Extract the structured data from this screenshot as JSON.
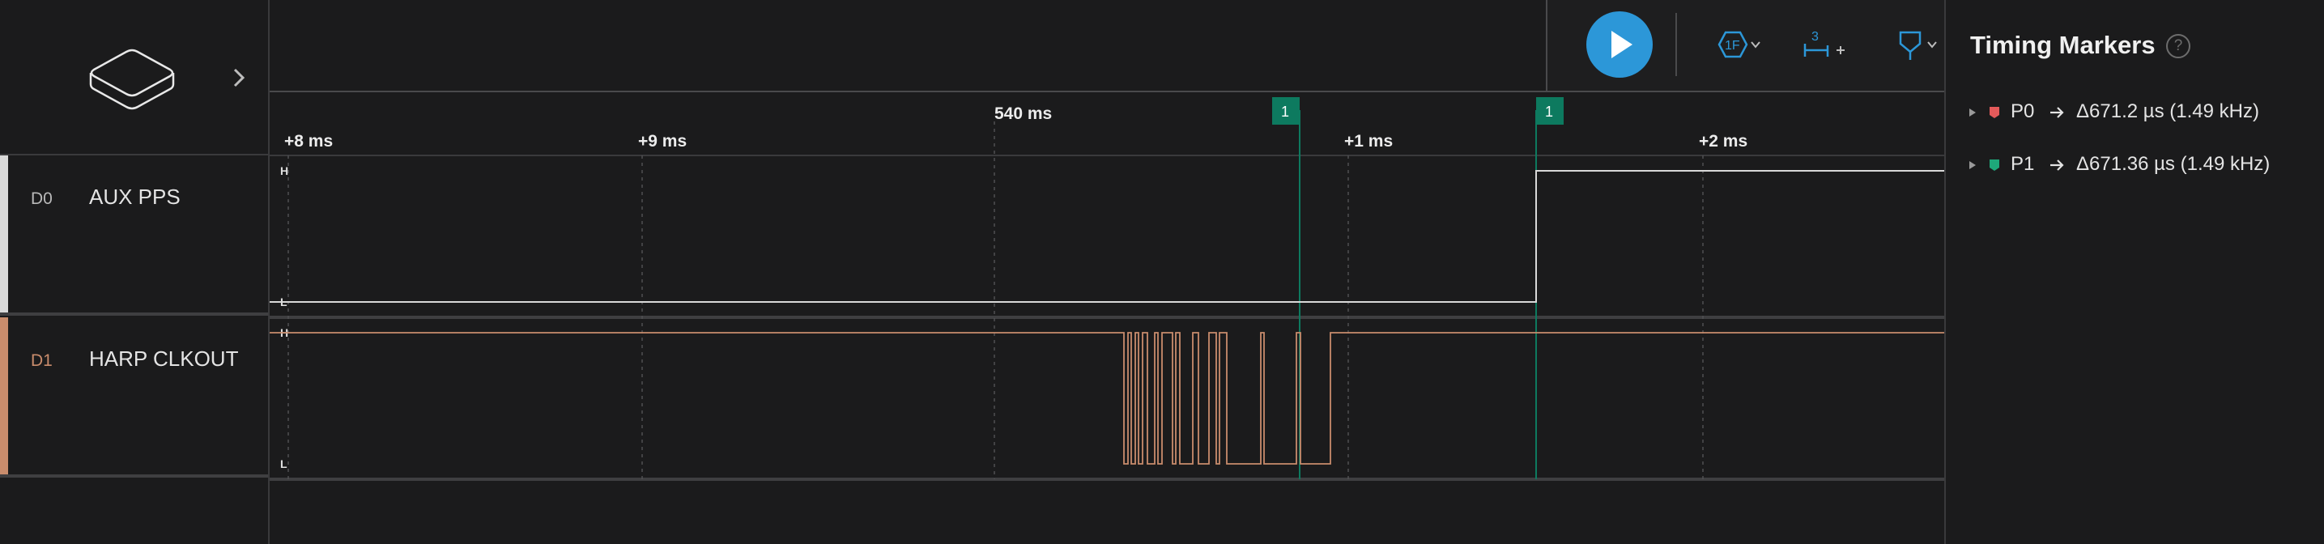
{
  "colors": {
    "background": "#1b1b1c",
    "grid": "#505052",
    "channel_0": "#d9d9d9",
    "channel_1": "#c98c6c",
    "marker": "#0d7a5f",
    "accent": "#2c97d8"
  },
  "device": {
    "icon": "device-icon",
    "expand_icon": "chevron-right-icon"
  },
  "toolbar": {
    "play_icon": "play-icon",
    "trigger_icon": "trigger-hexagon-icon",
    "trigger_text": "1F",
    "marker_add_icon": "marker-add-icon",
    "marker_add_text": "3",
    "measure_icon": "measure-probe-icon"
  },
  "timeline": {
    "center_label": "540 ms",
    "ticks": [
      "+8 ms",
      "+9 ms",
      "+1 ms",
      "+2 ms"
    ],
    "markers": [
      {
        "label": "1"
      },
      {
        "label": "1"
      }
    ]
  },
  "channels": [
    {
      "id": "D0",
      "name": "AUX PPS",
      "high_label": "H",
      "low_label": "L"
    },
    {
      "id": "D1",
      "name": "HARP CLKOUT",
      "high_label": "H",
      "low_label": "L"
    }
  ],
  "timing_markers": {
    "title": "Timing Markers",
    "help": "?",
    "items": [
      {
        "name": "P0",
        "value": "Δ671.2 µs (1.49 kHz)",
        "color": "#e45a5a"
      },
      {
        "name": "P1",
        "value": "Δ671.36 µs (1.49 kHz)",
        "color": "#1ea87a"
      }
    ]
  }
}
